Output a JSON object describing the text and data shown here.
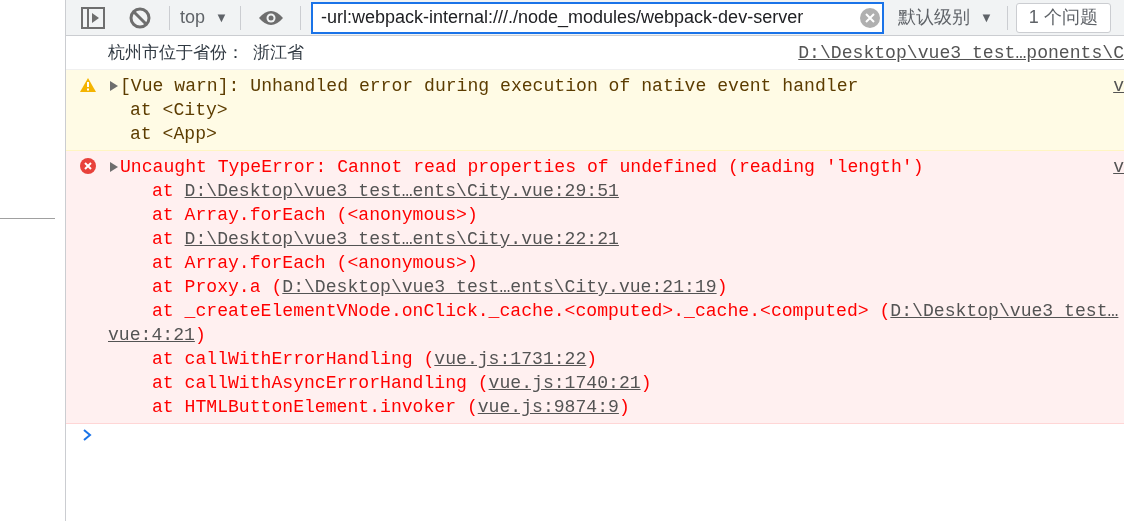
{
  "toolbar": {
    "context": "top",
    "context_arrow": "▼",
    "filter": {
      "value": "-url:webpack-internal:///./node_modules/webpack-dev-server"
    },
    "levels": "默认级别",
    "levels_arrow": "▼",
    "issues": "1 个问题"
  },
  "messages": [
    {
      "kind": "log",
      "text": "杭州市位于省份：  浙江省",
      "source": "D:\\Desktop\\vue3_test…ponents\\C"
    },
    {
      "kind": "warning",
      "expanded": false,
      "text": "[Vue warn]: Unhandled error during execution of native event handler",
      "source": "v",
      "lines": [
        {
          "kind": "trace",
          "parts": [
            {
              "kind": "text",
              "text": "at <City>"
            }
          ]
        },
        {
          "kind": "trace",
          "parts": [
            {
              "kind": "text",
              "text": "at <App>"
            }
          ]
        }
      ]
    },
    {
      "kind": "error",
      "expanded": false,
      "text": "Uncaught TypeError: Cannot read properties of undefined (reading 'length')",
      "source": "v",
      "lines": [
        {
          "kind": "stack",
          "parts": [
            {
              "kind": "text",
              "text": "at "
            },
            {
              "kind": "link",
              "text": "D:\\Desktop\\vue3_test…ents\\City.vue:29:51"
            }
          ]
        },
        {
          "kind": "stack",
          "parts": [
            {
              "kind": "text",
              "text": "at Array.forEach (<anonymous>)"
            }
          ]
        },
        {
          "kind": "stack",
          "parts": [
            {
              "kind": "text",
              "text": "at "
            },
            {
              "kind": "link",
              "text": "D:\\Desktop\\vue3_test…ents\\City.vue:22:21"
            }
          ]
        },
        {
          "kind": "stack",
          "parts": [
            {
              "kind": "text",
              "text": "at Array.forEach (<anonymous>)"
            }
          ]
        },
        {
          "kind": "stack",
          "parts": [
            {
              "kind": "text",
              "text": "at Proxy.a ("
            },
            {
              "kind": "link",
              "text": "D:\\Desktop\\vue3_test…ents\\City.vue:21:19"
            },
            {
              "kind": "text",
              "text": ")"
            }
          ]
        },
        {
          "kind": "stack",
          "parts": [
            {
              "kind": "text",
              "text": "at _createElementVNode.onClick._cache.<computed>._cache.<computed> ("
            },
            {
              "kind": "link",
              "text": "D:\\Desktop\\vue3_test…"
            }
          ]
        },
        {
          "kind": "wrap",
          "parts": [
            {
              "kind": "link",
              "text": "vue:4:21"
            },
            {
              "kind": "text",
              "text": ")"
            }
          ]
        },
        {
          "kind": "stack",
          "parts": [
            {
              "kind": "text",
              "text": "at callWithErrorHandling ("
            },
            {
              "kind": "link",
              "text": "vue.js:1731:22"
            },
            {
              "kind": "text",
              "text": ")"
            }
          ]
        },
        {
          "kind": "stack",
          "parts": [
            {
              "kind": "text",
              "text": "at callWithAsyncErrorHandling ("
            },
            {
              "kind": "link",
              "text": "vue.js:1740:21"
            },
            {
              "kind": "text",
              "text": ")"
            }
          ]
        },
        {
          "kind": "stack",
          "parts": [
            {
              "kind": "text",
              "text": "at HTMLButtonElement.invoker ("
            },
            {
              "kind": "link",
              "text": "vue.js:9874:9"
            },
            {
              "kind": "text",
              "text": ")"
            }
          ]
        }
      ]
    }
  ]
}
